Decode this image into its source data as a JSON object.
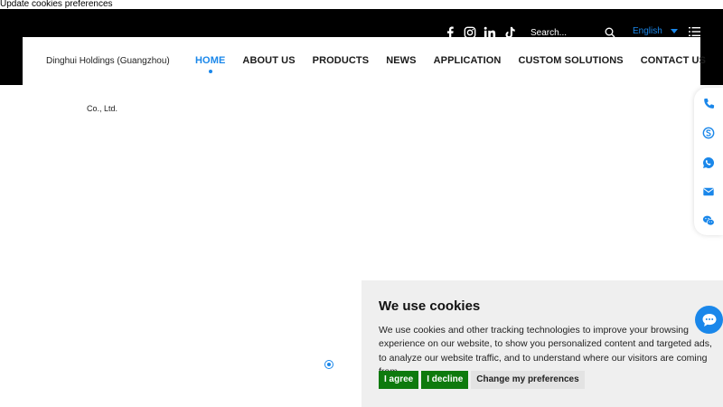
{
  "top_link": "Update cookies preferences",
  "header": {
    "social_icons": [
      "facebook-icon",
      "instagram-icon",
      "linkedin-icon",
      "tiktok-icon"
    ],
    "search": {
      "placeholder": "Search..."
    },
    "language": "English"
  },
  "brand": {
    "name_line1": "Dinghui Holdings (Guangzhou)",
    "name_line2": "Co., Ltd."
  },
  "nav": {
    "items": [
      {
        "label": "HOME",
        "active": true
      },
      {
        "label": "ABOUT US"
      },
      {
        "label": "PRODUCTS"
      },
      {
        "label": "NEWS"
      },
      {
        "label": "APPLICATION"
      },
      {
        "label": "CUSTOM SOLUTIONS"
      },
      {
        "label": "CONTACT US"
      }
    ]
  },
  "sidebar_icons": [
    "phone-icon",
    "skype-icon",
    "whatsapp-icon",
    "email-icon",
    "wechat-icon"
  ],
  "cookie_banner": {
    "title": "We use cookies",
    "text": "We use cookies and other tracking technologies to improve your browsing experience on our website, to show you personalized content and targeted ads, to analyze our website traffic, and to understand where our visitors are coming from.",
    "agree": "I agree",
    "decline": "I decline",
    "preferences": "Change my preferences"
  },
  "colors": {
    "accent": "#1a87ea",
    "header_bg": "#000000",
    "cookie_bg": "#efefef",
    "button_green": "#0e7a0d"
  }
}
